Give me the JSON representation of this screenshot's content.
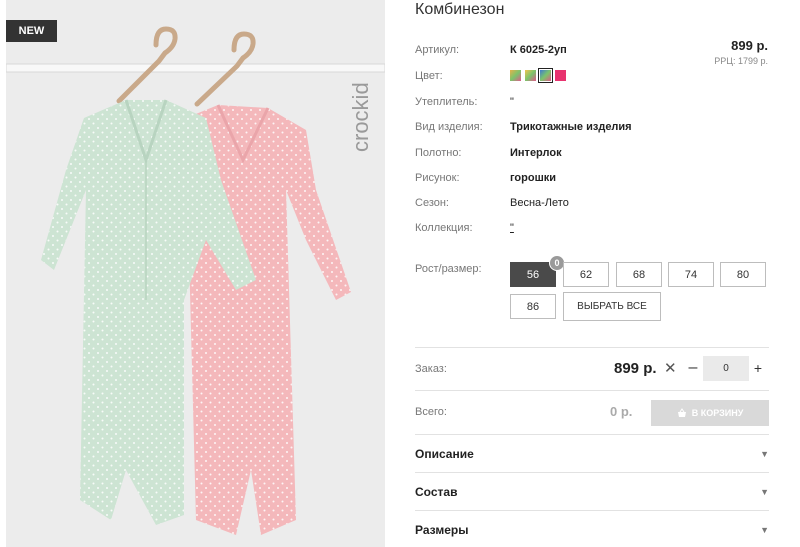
{
  "badge": "NEW",
  "brand": "crockid",
  "title": "Комбинезон",
  "price": "899 р.",
  "rrc": "РРЦ: 1799 р.",
  "attributes": {
    "article_label": "Артикул:",
    "article_value": "К 6025-2уп",
    "color_label": "Цвет:",
    "insulation_label": "Утеплитель:",
    "insulation_value": "\"",
    "type_label": "Вид изделия:",
    "type_value": "Трикотажные изделия",
    "fabric_label": "Полотно:",
    "fabric_value": "Интерлок",
    "pattern_label": "Рисунок:",
    "pattern_value": "горошки",
    "season_label": "Сезон:",
    "season_value": "Весна-Лето",
    "collection_label": "Коллекция:",
    "collection_value": "\""
  },
  "colors": [
    "#e8b04a",
    "#f2c24e",
    "#3f7ad1",
    "#e8336f"
  ],
  "size": {
    "label": "Рост/размер:",
    "options": [
      "56",
      "62",
      "68",
      "74",
      "80",
      "86"
    ],
    "selected": "56",
    "selected_count": "0",
    "select_all": "ВЫБРАТЬ ВСЕ"
  },
  "order": {
    "label": "Заказ:",
    "price": "899 р.",
    "times": "✕",
    "minus": "–",
    "qty": "0",
    "plus": "+"
  },
  "total": {
    "label": "Всего:",
    "value": "0 р.",
    "cart_button": "В КОРЗИНУ"
  },
  "accordions": [
    "Описание",
    "Состав",
    "Размеры"
  ]
}
